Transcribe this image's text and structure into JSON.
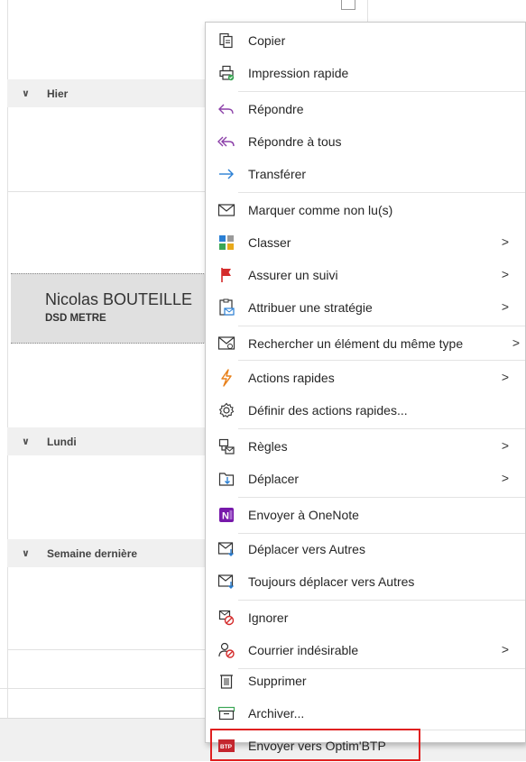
{
  "mail_list": {
    "groups": [
      {
        "label": "Hier"
      },
      {
        "label": "Lundi"
      },
      {
        "label": "Semaine dernière"
      }
    ],
    "selected_item": {
      "sender": "Nicolas BOUTEILLE",
      "subject": "DSD METRE"
    }
  },
  "context_menu": {
    "items": [
      {
        "label": "Copier",
        "icon": "copy-icon"
      },
      {
        "label": "Impression rapide",
        "icon": "quick-print-icon"
      },
      {
        "label": "Répondre",
        "icon": "reply-icon"
      },
      {
        "label": "Répondre à tous",
        "icon": "reply-all-icon"
      },
      {
        "label": "Transférer",
        "icon": "forward-icon"
      },
      {
        "label": "Marquer comme non lu(s)",
        "icon": "envelope-icon"
      },
      {
        "label": "Classer",
        "icon": "categorize-icon",
        "submenu": true
      },
      {
        "label": "Assurer un suivi",
        "icon": "flag-icon",
        "submenu": true
      },
      {
        "label": "Attribuer une stratégie",
        "icon": "policy-icon",
        "submenu": true
      },
      {
        "label": "Rechercher un élément du même type",
        "icon": "find-related-icon",
        "submenu": true
      },
      {
        "label": "Actions rapides",
        "icon": "lightning-icon",
        "submenu": true
      },
      {
        "label": "Définir des actions rapides...",
        "icon": "gear-icon"
      },
      {
        "label": "Règles",
        "icon": "rules-icon",
        "submenu": true
      },
      {
        "label": "Déplacer",
        "icon": "move-icon",
        "submenu": true
      },
      {
        "label": "Envoyer à OneNote",
        "icon": "onenote-icon"
      },
      {
        "label": "Déplacer vers Autres",
        "icon": "move-to-other-icon"
      },
      {
        "label": "Toujours déplacer vers Autres",
        "icon": "always-move-to-other-icon"
      },
      {
        "label": "Ignorer",
        "icon": "ignore-icon"
      },
      {
        "label": "Courrier indésirable",
        "icon": "junk-icon",
        "submenu": true
      },
      {
        "label": "Supprimer",
        "icon": "delete-icon"
      },
      {
        "label": "Archiver...",
        "icon": "archive-icon"
      },
      {
        "label": "Envoyer vers Optim'BTP",
        "icon": "optimbtp-icon"
      }
    ],
    "submenu_arrow": ">"
  },
  "colors": {
    "highlight_border": "#e02020",
    "flag_red": "#d42b2b",
    "reply_purple": "#8b3fa8",
    "forward_blue": "#2a7fd4",
    "lightning_orange": "#e8801a",
    "onenote_purple": "#7719aa"
  }
}
